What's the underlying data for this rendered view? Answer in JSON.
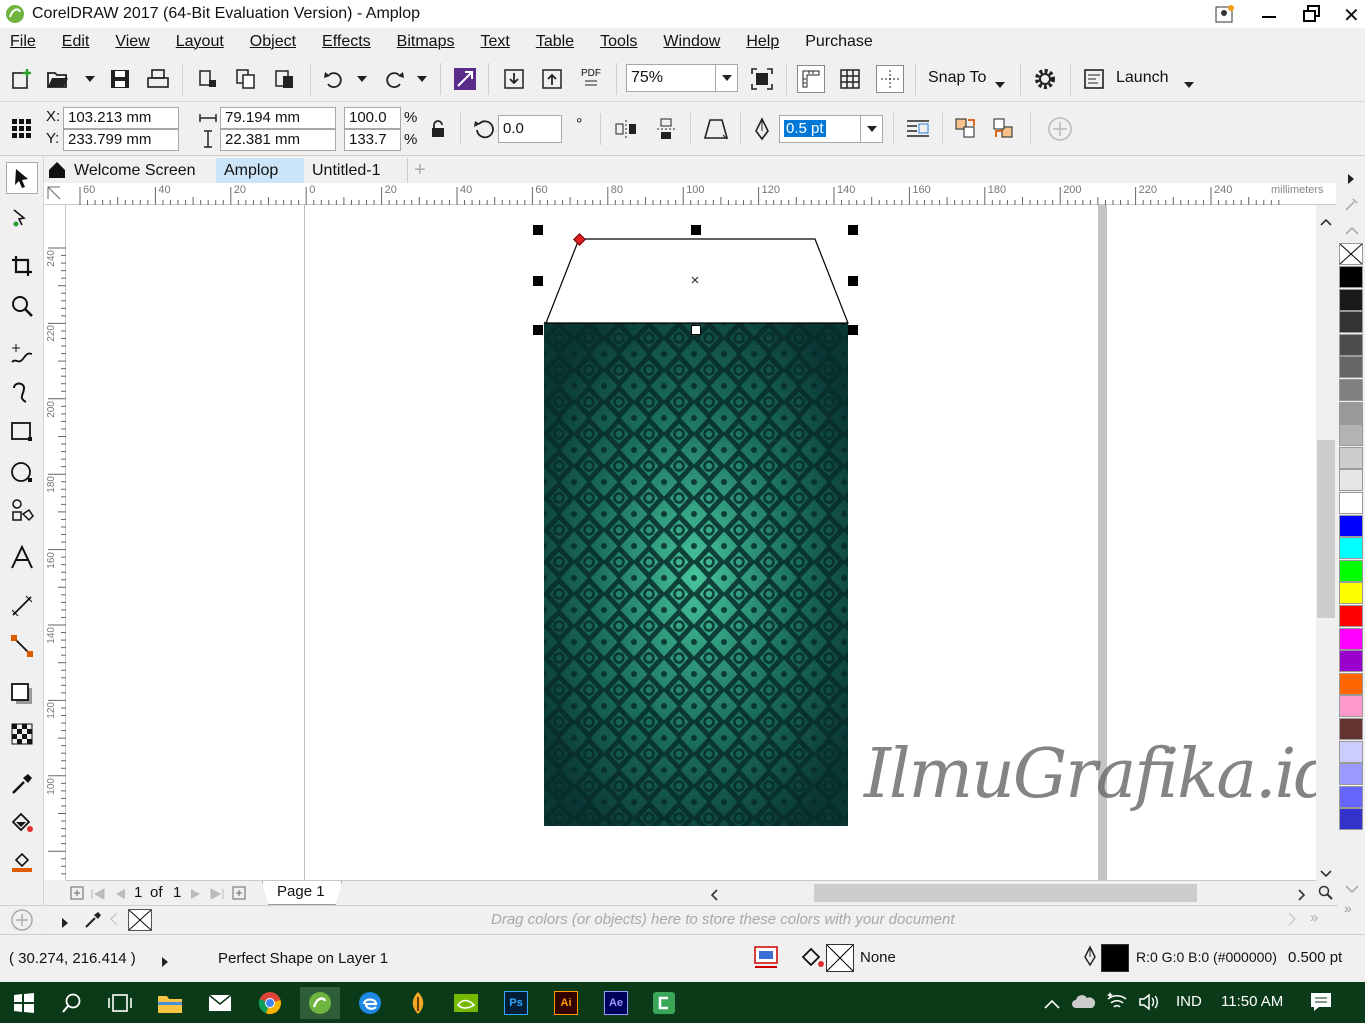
{
  "window": {
    "title": "CorelDRAW 2017 (64-Bit Evaluation Version) - Amplop",
    "minimize_icon": "minimize-icon",
    "restore_icon": "restore-icon",
    "close_icon": "close-icon"
  },
  "menu": {
    "items": [
      "File",
      "Edit",
      "View",
      "Layout",
      "Object",
      "Effects",
      "Bitmaps",
      "Text",
      "Table",
      "Tools",
      "Window",
      "Help",
      "Purchase"
    ]
  },
  "standard_toolbar": {
    "zoom": "75%",
    "snap_to": "Snap To",
    "launch": "Launch",
    "pdf_label": "PDF"
  },
  "property_bar": {
    "x": "103.213 mm",
    "y": "233.799 mm",
    "x_label": "X:",
    "y_label": "Y:",
    "width": "79.194 mm",
    "height": "22.381 mm",
    "scale_x": "100.0",
    "scale_y": "133.7",
    "percent": "%",
    "rotation": "0.0",
    "outline_width": "0.5 pt"
  },
  "tabs": [
    {
      "label": "Welcome Screen"
    },
    {
      "label": "Amplop"
    },
    {
      "label": "Untitled-1"
    }
  ],
  "ruler": {
    "h_ticks": [
      "60",
      "40",
      "20",
      "0",
      "20",
      "40",
      "60",
      "80",
      "100",
      "120",
      "140",
      "160",
      "180",
      "200",
      "220",
      "240"
    ],
    "v_ticks": [
      "240",
      "220",
      "200",
      "180",
      "160",
      "140",
      "120",
      "100"
    ],
    "unit": "millimeters"
  },
  "page_nav": {
    "current": "1",
    "of": "of",
    "total": "1",
    "page_tab": "Page 1"
  },
  "doc_palette": {
    "hint": "Drag colors (or objects) here to store these colors with your document"
  },
  "status": {
    "coords": "( 30.274, 216.414 )",
    "object_info": "Perfect Shape on Layer 1",
    "fill": "None",
    "outline_color": "R:0 G:0 B:0 (#000000)",
    "outline_width": "0.500 pt"
  },
  "watermark": "IlmuGrafika.id",
  "palette_colors": [
    "#000000",
    "#1a1a1a",
    "#333333",
    "#4d4d4d",
    "#666666",
    "#808080",
    "#999999",
    "#b3b3b3",
    "#cccccc",
    "#e6e6e6",
    "#ffffff",
    "#0000ff",
    "#00ffff",
    "#00ff00",
    "#ffff00",
    "#ff0000",
    "#ff00ff",
    "#9900cc",
    "#ff6600",
    "#ff99cc",
    "#663333",
    "#ccccff",
    "#9999ff",
    "#6666ff",
    "#3333cc"
  ],
  "taskbar": {
    "language": "IND",
    "time": "11:50 AM",
    "apps": [
      "windows-start-icon",
      "search-icon",
      "task-view-icon",
      "file-explorer-icon",
      "mail-icon",
      "chrome-icon",
      "coreldraw-icon",
      "edge-icon",
      "fl-studio-icon",
      "nvidia-icon",
      "photoshop-icon",
      "illustrator-icon",
      "after-effects-icon",
      "camtasia-icon"
    ],
    "ps": "Ps",
    "ai": "Ai",
    "ae": "Ae"
  }
}
